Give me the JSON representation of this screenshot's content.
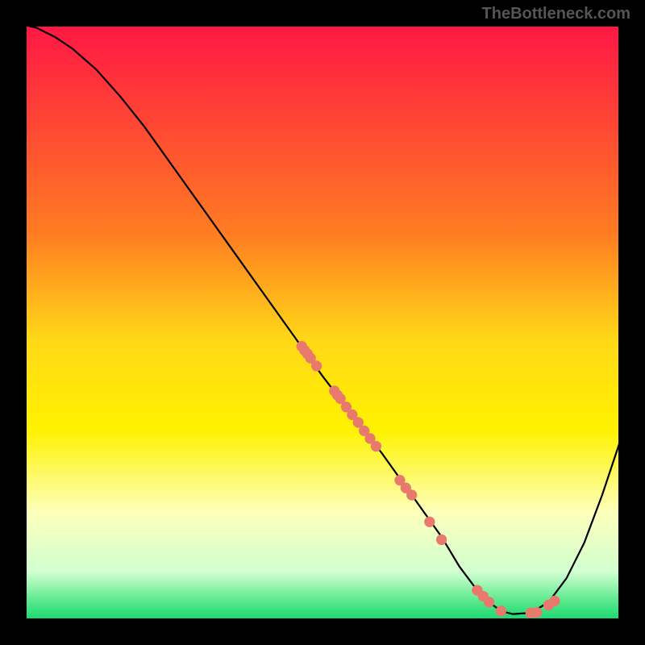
{
  "watermark": "TheBottleneck.com",
  "chart_data": {
    "type": "line",
    "xlim": [
      0,
      100
    ],
    "ylim": [
      0,
      100
    ],
    "title": "",
    "xlabel": "",
    "ylabel": "",
    "grid": false,
    "legend": false,
    "series": [
      {
        "name": "curve",
        "x": [
          0,
          2,
          5,
          8,
          12,
          16,
          20,
          25,
          30,
          35,
          40,
          45,
          50,
          55,
          60,
          65,
          70,
          73,
          76,
          78,
          80,
          82,
          85,
          88,
          91,
          94,
          97,
          100
        ],
        "y": [
          100,
          99.5,
          98,
          96,
          92.5,
          88,
          83,
          76,
          69,
          62,
          55,
          48,
          41,
          34.5,
          28,
          21,
          14,
          9,
          5,
          3,
          1.5,
          1,
          1.2,
          3,
          7,
          13,
          21,
          30
        ]
      },
      {
        "name": "scatter-points",
        "x": [
          46.5,
          47,
          47.5,
          48,
          49,
          52,
          52.5,
          53,
          54,
          55,
          56,
          57,
          58,
          59,
          63,
          64,
          65,
          68,
          70,
          76,
          77,
          78,
          80,
          85,
          86,
          88,
          89
        ],
        "y": [
          46,
          45.3,
          44.7,
          44,
          42.7,
          38.5,
          37.8,
          37.2,
          35.8,
          34.5,
          33.2,
          31.8,
          30.5,
          29.2,
          23.5,
          22.2,
          21,
          16.5,
          13.5,
          5,
          4,
          3,
          1.5,
          1.2,
          1.3,
          2.5,
          3.2
        ]
      }
    ],
    "gradient_stops": [
      {
        "offset": 0,
        "color": "#ff1744"
      },
      {
        "offset": 0.35,
        "color": "#ff7c22"
      },
      {
        "offset": 0.53,
        "color": "#ffd817"
      },
      {
        "offset": 0.68,
        "color": "#fff200"
      },
      {
        "offset": 0.82,
        "color": "#fdffbc"
      },
      {
        "offset": 0.92,
        "color": "#d0ffd0"
      },
      {
        "offset": 0.97,
        "color": "#55e88a"
      },
      {
        "offset": 1.0,
        "color": "#17d86f"
      }
    ],
    "point_color": "#e87a6d",
    "line_color": "#000000"
  }
}
